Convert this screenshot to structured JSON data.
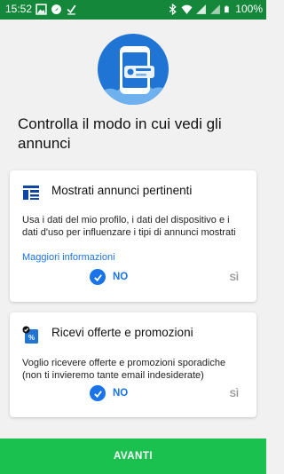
{
  "status_bar": {
    "time": "15:52",
    "battery": "100%",
    "icons": [
      "image-icon",
      "location-icon",
      "check-icon",
      "bluetooth-icon",
      "wifi-icon",
      "signal-icon",
      "battery-icon"
    ]
  },
  "hero": {
    "icon": "phone-ad-illustration-icon"
  },
  "headline": "Controlla il modo in cui vedi gli annunci",
  "cards": [
    {
      "title": "Mostrati annunci pertinenti",
      "icon": "ad-layout-icon",
      "description": "Usa i dati del mio profilo, i dati del dispositivo e i dati d'uso per influenzare i tipi di annunci mostrati",
      "link": "Maggiori informazioni",
      "option_no": "NO",
      "option_yes": "SÌ",
      "selected": "NO"
    },
    {
      "title": "Ricevi offerte e promozioni",
      "icon": "promo-tag-icon",
      "description": "Voglio ricevere offerte e promozioni sporadiche (non ti invieremo tante email indesiderate)",
      "option_no": "NO",
      "option_yes": "SÌ",
      "selected": "NO"
    }
  ],
  "next_button": "AVANTI",
  "colors": {
    "status_bar": "#14873b",
    "accent_blue": "#1a73e8",
    "hero_blue": "#1f74d4",
    "button_green": "#1bc14e",
    "background": "#f1f1f1"
  }
}
